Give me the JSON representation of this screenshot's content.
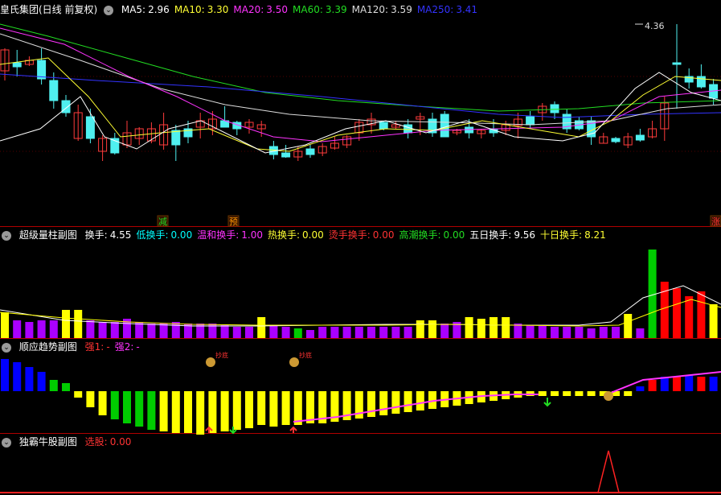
{
  "colors": {
    "up": "#ff3b3b",
    "down": "#4ff0f0",
    "ma5": "#ffffff",
    "ma10": "#ffff33",
    "ma20": "#ff33ff",
    "ma60": "#22dd22",
    "ma120": "#dddddd",
    "ma250": "#3333ff",
    "yellow": "#ffff00",
    "purple": "#aa00ff",
    "green": "#00cc00",
    "blue": "#0000ff",
    "magenta": "#ff33ff",
    "red": "#ff0000"
  },
  "main": {
    "title": "皇氏集团(日线 前复权)",
    "ma": [
      {
        "label": "MA5:",
        "value": "2.96",
        "color": "#ffffff"
      },
      {
        "label": "MA10:",
        "value": "3.30",
        "color": "#ffff33"
      },
      {
        "label": "MA20:",
        "value": "3.50",
        "color": "#ff33ff"
      },
      {
        "label": "MA60:",
        "value": "3.39",
        "color": "#22dd22"
      },
      {
        "label": "MA120:",
        "value": "3.59",
        "color": "#dddddd"
      },
      {
        "label": "MA250:",
        "value": "3.41",
        "color": "#3333ff"
      }
    ],
    "high_label": "4.36",
    "markers": [
      {
        "text": "减",
        "color": "#22dd22"
      },
      {
        "text": "预",
        "color": "#ff9900"
      },
      {
        "text": "涨",
        "color": "#ff3333"
      }
    ]
  },
  "panel2": {
    "title": "超级量柱副图",
    "items": [
      {
        "label": "换手:",
        "value": "4.55",
        "color": "#ffffff"
      },
      {
        "label": "低换手:",
        "value": "0.00",
        "color": "#00ffff"
      },
      {
        "label": "温和换手:",
        "value": "1.00",
        "color": "#ff33ff"
      },
      {
        "label": "热换手:",
        "value": "0.00",
        "color": "#ffff33"
      },
      {
        "label": "烫手换手:",
        "value": "0.00",
        "color": "#ff3333"
      },
      {
        "label": "高潮换手:",
        "value": "0.00",
        "color": "#22dd22"
      },
      {
        "label": "五日换手:",
        "value": "9.56",
        "color": "#ffffff"
      },
      {
        "label": "十日换手:",
        "value": "8.21",
        "color": "#ffff33"
      }
    ]
  },
  "panel3": {
    "title": "顺应趋势副图",
    "items": [
      {
        "label": "强1:",
        "value": "-",
        "color": "#ff3333"
      },
      {
        "label": "强2:",
        "value": "-",
        "color": "#ff33ff"
      }
    ],
    "buy_label": "抄底"
  },
  "panel4": {
    "title": "独霸牛股副图",
    "items": [
      {
        "label": "选股:",
        "value": "0.00",
        "color": "#ff3333"
      }
    ]
  }
}
